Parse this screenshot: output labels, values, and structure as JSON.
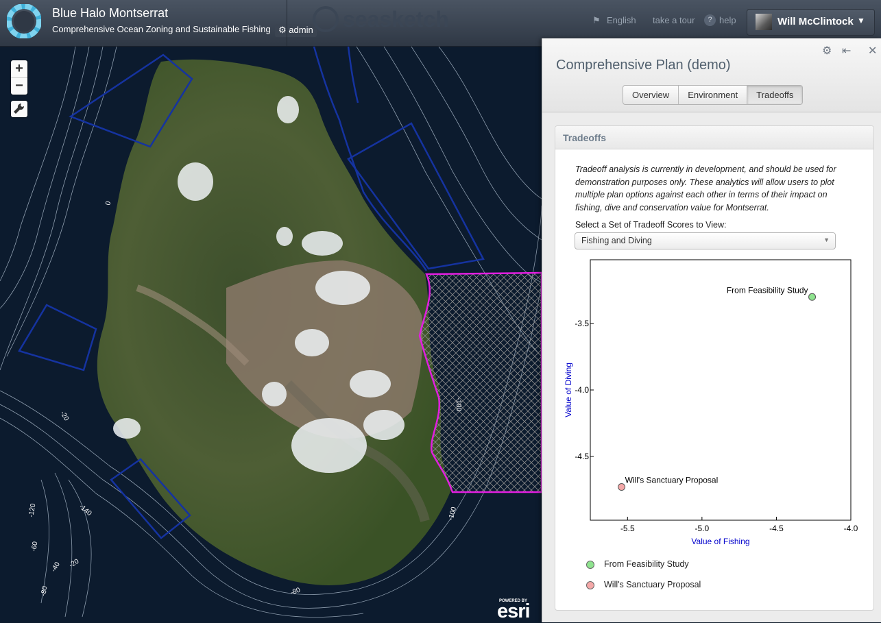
{
  "app": {
    "title": "Blue Halo Montserrat",
    "subtitle": "Comprehensive Ocean Zoning and Sustainable Fishing",
    "admin_label": "admin",
    "brand": "seasketch"
  },
  "topnav": {
    "language": "English",
    "tour": "take a tour",
    "help": "help",
    "help_icon_char": "?",
    "user_name": "Will McClintock"
  },
  "map_controls": {
    "zoom_in": "+",
    "zoom_out": "−",
    "contour_labels": [
      "0",
      "-20",
      "-100",
      "-120",
      "-140",
      "-60",
      "-40",
      "-20",
      "-80",
      "-80",
      "-100"
    ],
    "attribution_small": "POWERED BY",
    "attribution_big": "esri"
  },
  "panel": {
    "title": "Comprehensive Plan (demo)",
    "tabs": [
      {
        "label": "Overview",
        "active": false
      },
      {
        "label": "Environment",
        "active": false
      },
      {
        "label": "Tradeoffs",
        "active": true
      }
    ],
    "card_title": "Tradeoffs",
    "description": "Tradeoff analysis is currently in development, and should be used for demonstration purposes only. These analytics will allow users to plot multiple plan options against each other in terms of their impact on fishing, dive and conservation value for Montserrat.",
    "select_label": "Select a Set of Tradeoff Scores to View:",
    "select_value": "Fishing and Diving"
  },
  "colors": {
    "accent_blue": "#0000cc",
    "zone_outline": "#1533a0",
    "marine_reserve": "#e21ee0",
    "point_green": "#8fe38f",
    "point_pink": "#f4a8a8"
  },
  "chart_data": {
    "type": "scatter",
    "xlabel": "Value of Fishing",
    "ylabel": "Value of Diving",
    "xlim": [
      -5.75,
      -4.0
    ],
    "ylim": [
      -4.98,
      -3.02
    ],
    "xticks": [
      -5.5,
      -5.0,
      -4.5,
      -4.0
    ],
    "yticks": [
      -3.5,
      -4.0,
      -4.5
    ],
    "grid": false,
    "legend": "bottom",
    "series": [
      {
        "name": "From Feasibility Study",
        "points": [
          {
            "x": -4.26,
            "y": -3.3
          }
        ],
        "color": "#8fe38f"
      },
      {
        "name": "Will's Sanctuary Proposal",
        "points": [
          {
            "x": -5.54,
            "y": -4.73
          }
        ],
        "color": "#f4a8a8"
      }
    ]
  }
}
